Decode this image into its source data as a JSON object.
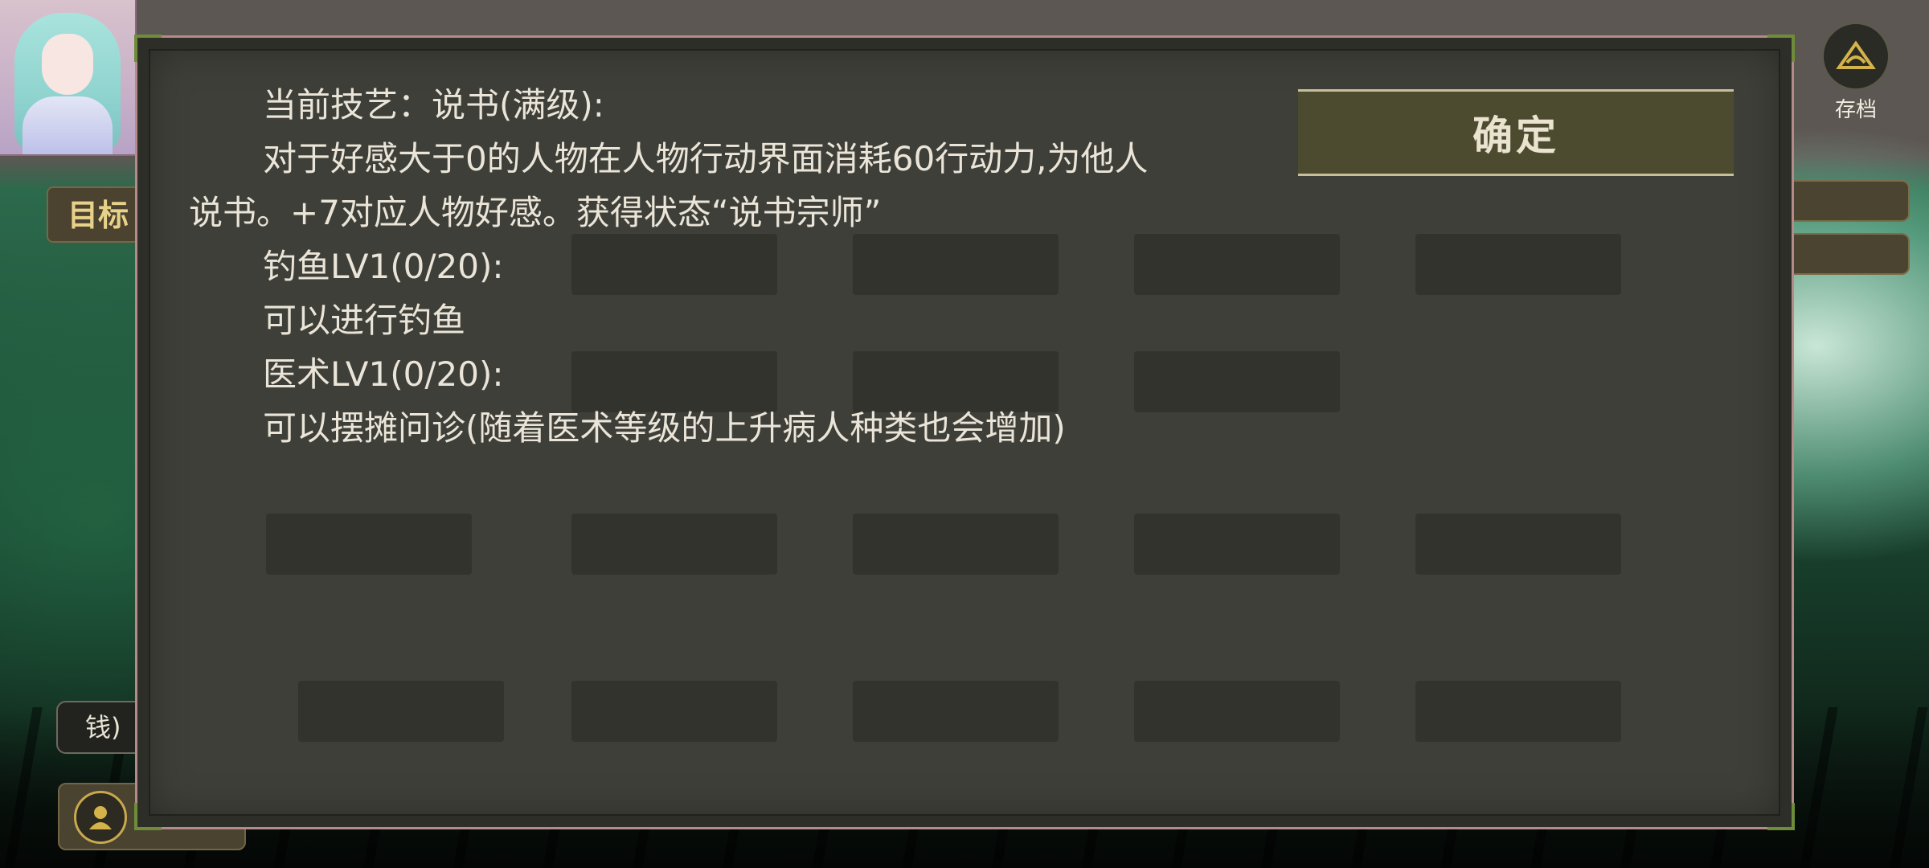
{
  "hud": {
    "save_label": "存档",
    "left_tab_label": "目标",
    "money_label": "钱)"
  },
  "dialog": {
    "confirm_label": "确定",
    "lines": [
      "当前技艺：说书(满级):",
      "对于好感大于0的人物在人物行动界面消耗60行动力,为他人",
      "说书。+7对应人物好感。获得状态“说书宗师”",
      "钓鱼LV1(0/20):",
      "可以进行钓鱼",
      "医术LV1(0/20):",
      "可以摆摊问诊(随着医术等级的上升病人种类也会增加)"
    ]
  },
  "colors": {
    "modal_bg": "#3f3f39",
    "modal_border": "#b48a8a",
    "corner_accent": "#6e8c3a",
    "button_bg": "#4c4b30",
    "text": "#eae5d8"
  },
  "icons": [
    "save-icon",
    "user-icon"
  ]
}
